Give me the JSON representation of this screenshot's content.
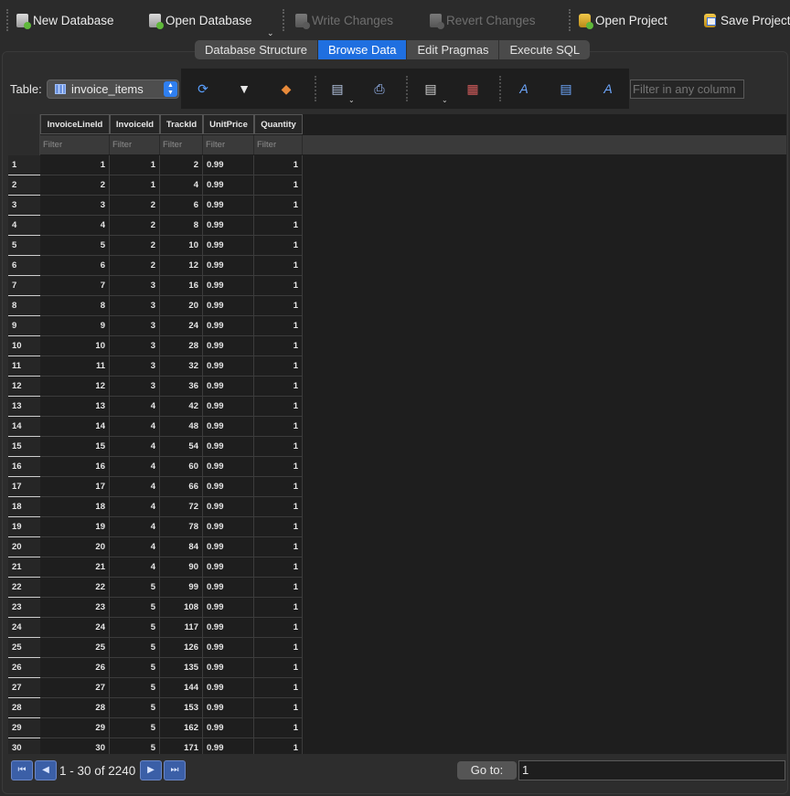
{
  "toolbar": {
    "new_database": "New Database",
    "open_database": "Open Database",
    "write_changes": "Write Changes",
    "revert_changes": "Revert Changes",
    "open_project": "Open Project",
    "save_project": "Save Project"
  },
  "tabs": [
    {
      "label": "Database Structure"
    },
    {
      "label": "Browse Data",
      "active": true
    },
    {
      "label": "Edit Pragmas"
    },
    {
      "label": "Execute SQL"
    }
  ],
  "browse": {
    "table_label": "Table:",
    "selected_table": "invoice_items",
    "filter_any_placeholder": "Filter in any column"
  },
  "grid": {
    "columns": [
      "InvoiceLineId",
      "InvoiceId",
      "TrackId",
      "UnitPrice",
      "Quantity"
    ],
    "filter_placeholder": "Filter",
    "rows": [
      [
        "1",
        "1",
        "1",
        "2",
        "0.99",
        "1"
      ],
      [
        "2",
        "2",
        "1",
        "4",
        "0.99",
        "1"
      ],
      [
        "3",
        "3",
        "2",
        "6",
        "0.99",
        "1"
      ],
      [
        "4",
        "4",
        "2",
        "8",
        "0.99",
        "1"
      ],
      [
        "5",
        "5",
        "2",
        "10",
        "0.99",
        "1"
      ],
      [
        "6",
        "6",
        "2",
        "12",
        "0.99",
        "1"
      ],
      [
        "7",
        "7",
        "3",
        "16",
        "0.99",
        "1"
      ],
      [
        "8",
        "8",
        "3",
        "20",
        "0.99",
        "1"
      ],
      [
        "9",
        "9",
        "3",
        "24",
        "0.99",
        "1"
      ],
      [
        "10",
        "10",
        "3",
        "28",
        "0.99",
        "1"
      ],
      [
        "11",
        "11",
        "3",
        "32",
        "0.99",
        "1"
      ],
      [
        "12",
        "12",
        "3",
        "36",
        "0.99",
        "1"
      ],
      [
        "13",
        "13",
        "4",
        "42",
        "0.99",
        "1"
      ],
      [
        "14",
        "14",
        "4",
        "48",
        "0.99",
        "1"
      ],
      [
        "15",
        "15",
        "4",
        "54",
        "0.99",
        "1"
      ],
      [
        "16",
        "16",
        "4",
        "60",
        "0.99",
        "1"
      ],
      [
        "17",
        "17",
        "4",
        "66",
        "0.99",
        "1"
      ],
      [
        "18",
        "18",
        "4",
        "72",
        "0.99",
        "1"
      ],
      [
        "19",
        "19",
        "4",
        "78",
        "0.99",
        "1"
      ],
      [
        "20",
        "20",
        "4",
        "84",
        "0.99",
        "1"
      ],
      [
        "21",
        "21",
        "4",
        "90",
        "0.99",
        "1"
      ],
      [
        "22",
        "22",
        "5",
        "99",
        "0.99",
        "1"
      ],
      [
        "23",
        "23",
        "5",
        "108",
        "0.99",
        "1"
      ],
      [
        "24",
        "24",
        "5",
        "117",
        "0.99",
        "1"
      ],
      [
        "25",
        "25",
        "5",
        "126",
        "0.99",
        "1"
      ],
      [
        "26",
        "26",
        "5",
        "135",
        "0.99",
        "1"
      ],
      [
        "27",
        "27",
        "5",
        "144",
        "0.99",
        "1"
      ],
      [
        "28",
        "28",
        "5",
        "153",
        "0.99",
        "1"
      ],
      [
        "29",
        "29",
        "5",
        "162",
        "0.99",
        "1"
      ],
      [
        "30",
        "30",
        "5",
        "171",
        "0.99",
        "1"
      ]
    ]
  },
  "pagination": {
    "range_text": "1 - 30 of 2240",
    "goto_label": "Go to:",
    "goto_value": "1"
  },
  "colors": {
    "accent": "#1f6fe0",
    "background": "#2b2b2b",
    "grid_background": "#1e1e1e"
  }
}
